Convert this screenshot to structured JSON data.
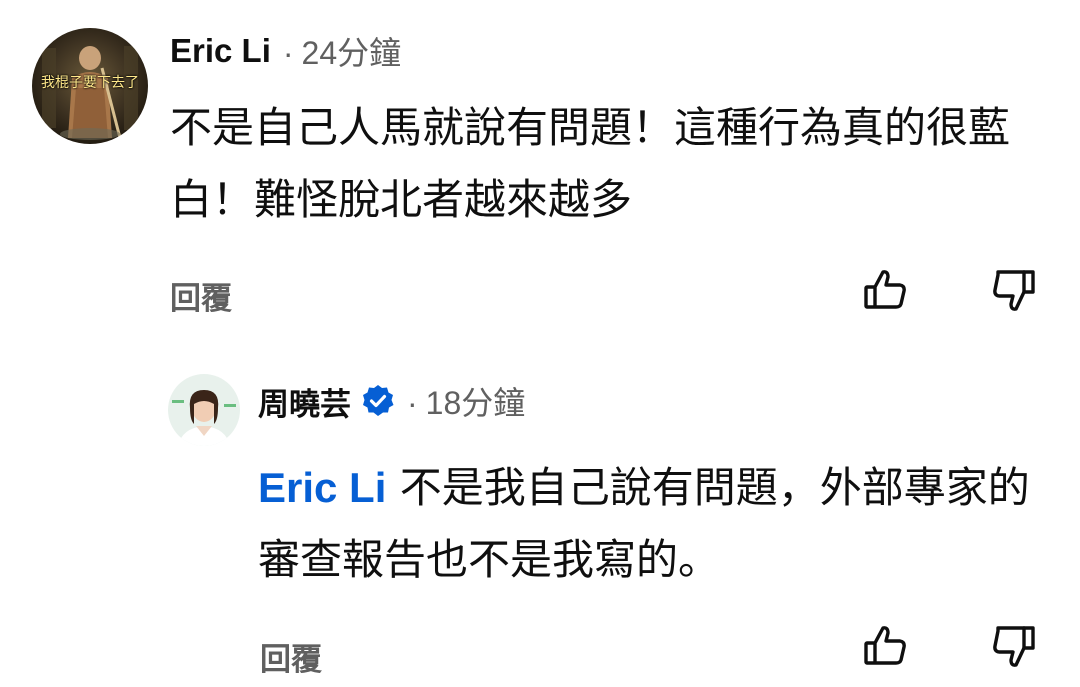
{
  "comments": [
    {
      "author": "Eric Li",
      "time": "24分鐘",
      "separator": "·",
      "avatar_caption": "我棍子要下去了",
      "text": "不是自己人馬就說有問題！這種行為真的很藍白！難怪脫北者越來越多",
      "reply_label": "回覆"
    },
    {
      "author": "周曉芸",
      "verified": true,
      "time": "18分鐘",
      "separator": "·",
      "mention": "Eric Li",
      "text": " 不是我自己說有問題，外部專家的審查報告也不是我寫的。",
      "reply_label": "回覆"
    }
  ],
  "icons": {
    "like": "thumbs-up-icon",
    "dislike": "thumbs-down-icon",
    "verified": "verified-check-icon"
  },
  "colors": {
    "mention": "#065fd4",
    "verified_badge": "#065fd4",
    "secondary_text": "#606060"
  }
}
